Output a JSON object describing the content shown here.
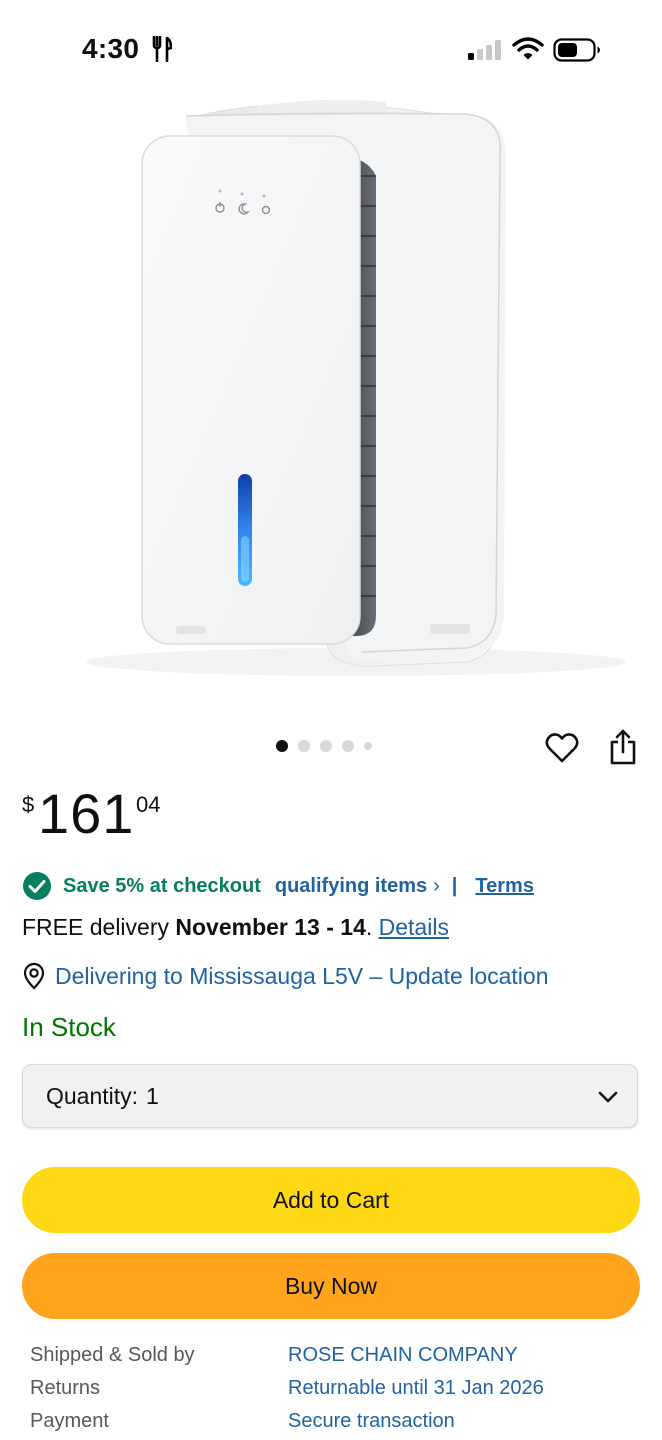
{
  "status_bar": {
    "time": "4:30"
  },
  "carousel": {
    "count": 5,
    "active": 0
  },
  "price": {
    "symbol": "$",
    "whole": "161",
    "fraction": "04"
  },
  "promo": {
    "save_text": "Save 5% at checkout",
    "qualifying_link": "qualifying items",
    "chevron": "›",
    "separator": "|",
    "terms_link": "Terms"
  },
  "delivery": {
    "prefix": "FREE delivery ",
    "dates": "November 13 - 14",
    "suffix": ". ",
    "details_link": "Details"
  },
  "location": {
    "text": "Delivering to Mississauga L5V – Update location"
  },
  "stock": {
    "status": "In Stock"
  },
  "quantity": {
    "label": "Quantity:",
    "value": "1"
  },
  "buttons": {
    "add_to_cart": "Add to Cart",
    "buy_now": "Buy Now"
  },
  "info": {
    "rows": [
      {
        "key": "Shipped & Sold by",
        "value": "ROSE CHAIN COMPANY"
      },
      {
        "key": "Returns",
        "value": "Returnable until 31 Jan 2026"
      },
      {
        "key": "Payment",
        "value": "Secure transaction"
      }
    ]
  },
  "colors": {
    "link": "#2162a1",
    "save_green": "#067d62",
    "stock_green": "#007600",
    "add_to_cart": "#ffd814",
    "buy_now": "#ffa41c"
  },
  "icons": [
    "fork-knife-icon",
    "signal-icon",
    "wifi-icon",
    "battery-icon",
    "heart-icon",
    "share-icon",
    "check-badge-icon",
    "location-pin-icon",
    "chevron-down-icon"
  ]
}
